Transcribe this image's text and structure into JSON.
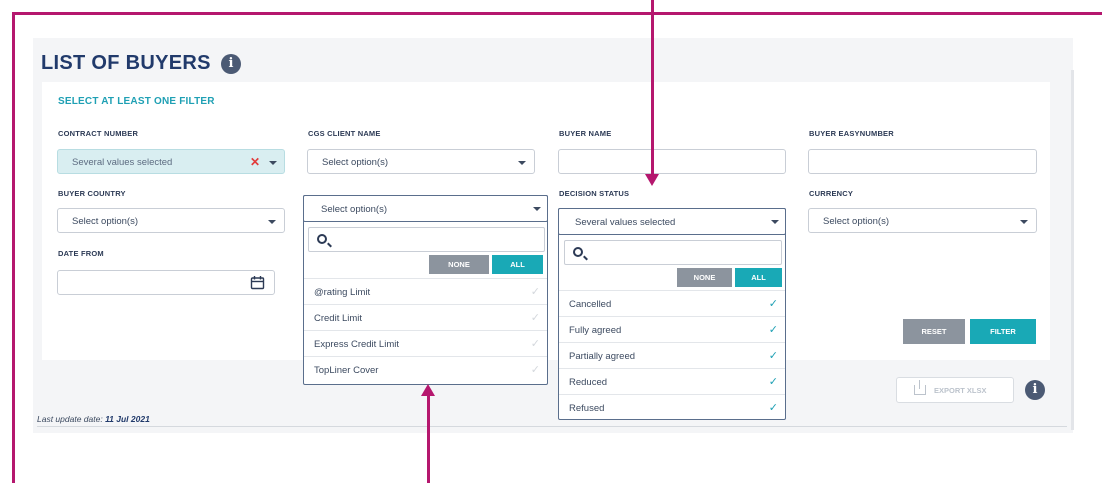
{
  "page": {
    "title": "LIST OF BUYERS",
    "info_icon": "i",
    "subheading": "SELECT AT LEAST ONE FILTER"
  },
  "filters": {
    "contract_number": {
      "label": "CONTRACT NUMBER",
      "value": "Several values selected",
      "clear_glyph": "✕"
    },
    "cgs_client_name": {
      "label": "CGS CLIENT NAME",
      "value": "Select option(s)"
    },
    "buyer_name": {
      "label": "BUYER NAME",
      "value": ""
    },
    "buyer_easynumber": {
      "label": "BUYER EASYNUMBER",
      "value": ""
    },
    "buyer_country": {
      "label": "BUYER COUNTRY",
      "value": "Select option(s)"
    },
    "decision_status": {
      "label": "DECISION STATUS",
      "value": "Several values selected"
    },
    "currency": {
      "label": "CURRENCY",
      "value": "Select option(s)"
    },
    "date_from": {
      "label": "DATE FROM",
      "value": ""
    }
  },
  "limit_type_dropdown": {
    "value": "Select option(s)",
    "none_label": "NONE",
    "all_label": "ALL",
    "options": [
      {
        "label": "@rating Limit",
        "checked": false
      },
      {
        "label": "Credit Limit",
        "checked": false
      },
      {
        "label": "Express Credit Limit",
        "checked": false
      },
      {
        "label": "TopLiner Cover",
        "checked": false
      }
    ]
  },
  "decision_status_dropdown": {
    "none_label": "NONE",
    "all_label": "ALL",
    "options": [
      {
        "label": "Cancelled",
        "checked": true
      },
      {
        "label": "Fully agreed",
        "checked": true
      },
      {
        "label": "Partially agreed",
        "checked": true
      },
      {
        "label": "Reduced",
        "checked": true
      },
      {
        "label": "Refused",
        "checked": true
      }
    ]
  },
  "actions": {
    "reset_label": "RESET",
    "filter_label": "FILTER",
    "export_label": "EXPORT XLSX"
  },
  "footer": {
    "last_update_prefix": "Last update date:",
    "last_update_date": "11 Jul 2021"
  },
  "icons": {
    "check": "✓",
    "calendar": "calendar-icon",
    "search": "search-icon"
  },
  "colors": {
    "annotation": "#b5176e",
    "accent": "#19a9b6",
    "title": "#213a6b",
    "neutral_button": "#8c949e"
  }
}
